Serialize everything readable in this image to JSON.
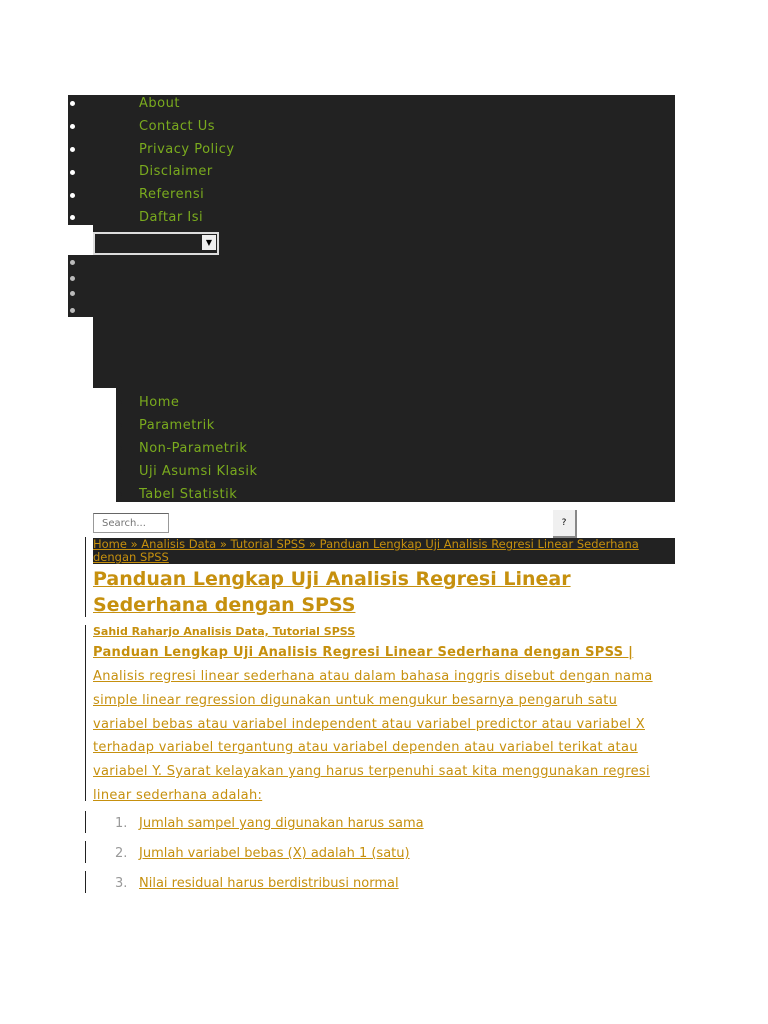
{
  "top_nav": {
    "items": [
      "About",
      "Contact Us",
      "Privacy Policy",
      "Disclaimer",
      "Referensi",
      "Daftar Isi"
    ]
  },
  "dropdown": {
    "value": ""
  },
  "main_nav": {
    "items": [
      "Home",
      "Parametrik",
      "Non-Parametrik",
      "Uji Asumsi Klasik",
      "Tabel Statistik"
    ]
  },
  "search": {
    "placeholder": "Search...",
    "button": "?"
  },
  "breadcrumb": "Home » Analisis Data » Tutorial SPSS » Panduan Lengkap Uji Analisis Regresi Linear Sederhana dengan SPSS",
  "post": {
    "title": "Panduan Lengkap Uji Analisis Regresi Linear Sederhana dengan SPSS",
    "meta": "Sahid Raharjo Analisis Data, Tutorial SPSS",
    "lead": "Panduan Lengkap Uji Analisis Regresi Linear Sederhana dengan SPSS |",
    "body": "Analisis regresi linear sederhana atau dalam bahasa inggris disebut dengan nama simple linear regression digunakan untuk mengukur besarnya pengaruh satu variabel bebas atau variabel independent atau variabel predictor atau variabel X terhadap variabel tergantung atau variabel dependen atau variabel terikat atau variabel Y. Syarat kelayakan yang harus terpenuhi saat kita menggunakan regresi linear sederhana adalah:",
    "list": [
      {
        "n": "1.",
        "t": "Jumlah sampel yang digunakan harus sama"
      },
      {
        "n": "2.",
        "t": "Jumlah variabel bebas (X) adalah 1 (satu)"
      },
      {
        "n": "3.",
        "t": "Nilai residual harus berdistribusi normal"
      }
    ]
  }
}
